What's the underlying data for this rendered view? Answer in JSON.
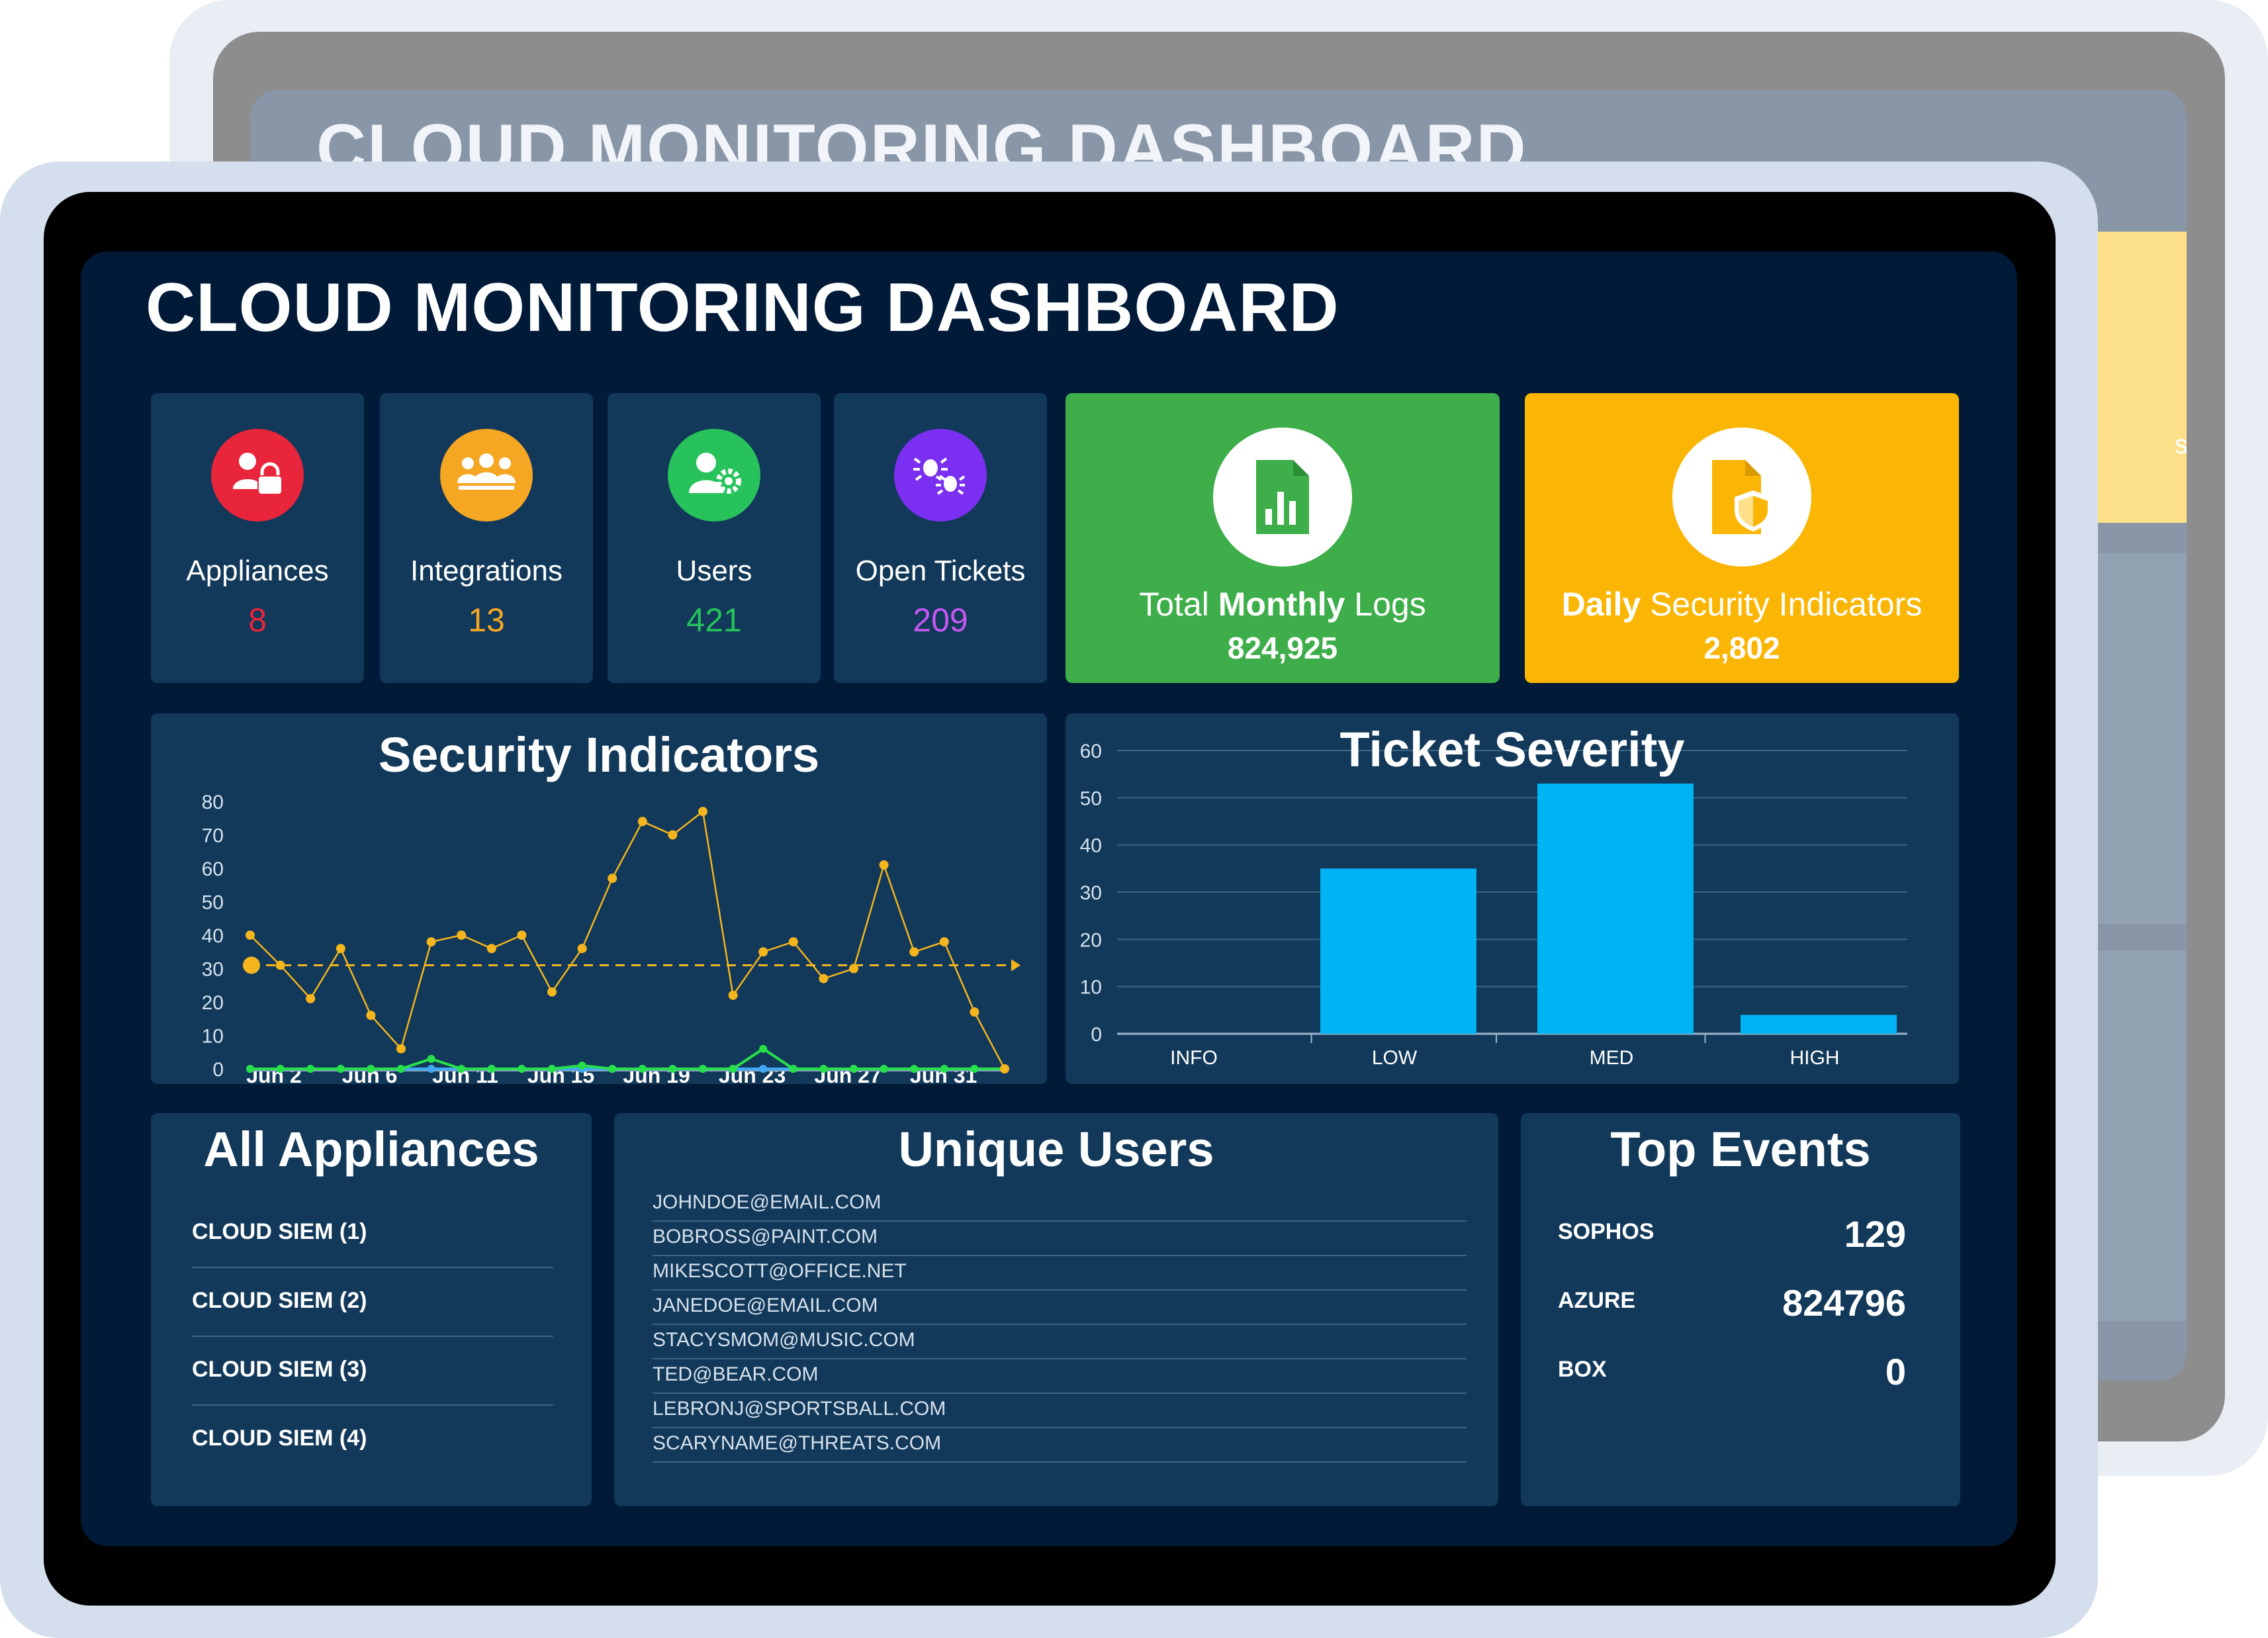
{
  "background_title": "CLOUD MONITORING DASHBOARD",
  "title": "CLOUD MONITORING DASHBOARD",
  "stats": [
    {
      "label": "Appliances",
      "value": "8",
      "color": "#e8253a",
      "icon": "appliance-lock-icon"
    },
    {
      "label": "Integrations",
      "value": "13",
      "color": "#f5a623",
      "icon": "team-icon"
    },
    {
      "label": "Users",
      "value": "421",
      "color": "#27c25c",
      "icon": "user-gear-icon"
    },
    {
      "label": "Open Tickets",
      "value": "209",
      "color": "#b64cf0",
      "icon": "bug-icon"
    }
  ],
  "monthly_logs": {
    "label_pre": "Total ",
    "label_bold": "Monthly",
    "label_post": " Logs",
    "value": "824,925",
    "color": "#3dae4a",
    "icon": "document-chart-icon"
  },
  "daily_indicators": {
    "label_bold": "Daily",
    "label_post": " Security Indicators",
    "value": "2,802",
    "color": "#fbb504",
    "icon": "document-shield-icon"
  },
  "security_chart": {
    "title": "Security Indicators",
    "yticks": [
      "0",
      "10",
      "20",
      "30",
      "40",
      "50",
      "60",
      "70",
      "80"
    ],
    "xticks": [
      "Jun 2",
      "Jun 6",
      "Jun 11",
      "Jun 15",
      "Jun 19",
      "Jun 23",
      "Jun 27",
      "Jun 31"
    ]
  },
  "severity_chart": {
    "title": "Ticket Severity",
    "yticks": [
      "0",
      "10",
      "20",
      "30",
      "40",
      "50",
      "60"
    ]
  },
  "chart_data": [
    {
      "type": "line",
      "title": "Security Indicators",
      "ylim": [
        0,
        80
      ],
      "x_tick_labels": [
        "Jun 2",
        "Jun 6",
        "Jun 11",
        "Jun 15",
        "Jun 19",
        "Jun 23",
        "Jun 27",
        "Jun 31"
      ],
      "x": [
        0,
        1,
        2,
        3,
        4,
        5,
        6,
        7,
        8,
        9,
        10,
        11,
        12,
        13,
        14,
        15,
        16,
        17,
        18,
        19,
        20,
        21,
        22,
        23,
        24,
        25,
        26,
        27,
        28,
        29,
        30,
        31,
        32
      ],
      "series": [
        {
          "color": "#f5b51c",
          "values": [
            40,
            31,
            21,
            36,
            16,
            6,
            38,
            40,
            36,
            40,
            23,
            36,
            57,
            74,
            70,
            77,
            22,
            35,
            38,
            27,
            30,
            61,
            35,
            38,
            17,
            0
          ]
        },
        {
          "color": "#27e04a",
          "values": [
            0,
            0,
            0,
            0,
            0,
            0,
            3,
            0,
            0,
            0,
            0,
            1,
            0,
            0,
            0,
            0,
            0,
            6,
            0,
            0,
            0,
            0,
            0,
            0,
            0,
            0
          ]
        },
        {
          "color": "#3fa9f5",
          "values": [
            0,
            0,
            0,
            0,
            0,
            0,
            0,
            0,
            0,
            0,
            0,
            0,
            0,
            0,
            0,
            0,
            0,
            0,
            0,
            0,
            0,
            0,
            0,
            0,
            0,
            0
          ]
        }
      ],
      "average": 31,
      "grid": false
    },
    {
      "type": "bar",
      "title": "Ticket Severity",
      "categories": [
        "INFO",
        "LOW",
        "MED",
        "HIGH"
      ],
      "values": [
        0,
        35,
        53,
        4
      ],
      "ylim": [
        0,
        60
      ],
      "grid": true,
      "color": "#00b3f5"
    }
  ],
  "appliances": {
    "title": "All Appliances",
    "items": [
      "CLOUD SIEM (1)",
      "CLOUD SIEM (2)",
      "CLOUD SIEM (3)",
      "CLOUD SIEM (4)"
    ]
  },
  "unique_users": {
    "title": "Unique Users",
    "items": [
      "JOHNDOE@EMAIL.COM",
      "BOBROSS@PAINT.COM",
      "MIKESCOTT@OFFICE.NET",
      "JANEDOE@EMAIL.COM",
      "STACYSMOM@MUSIC.COM",
      "TED@BEAR.COM",
      "LEBRONJ@SPORTSBALL.COM",
      "SCARYNAME@THREATS.COM"
    ]
  },
  "top_events": {
    "title": "Top Events",
    "items": [
      {
        "name": "SOPHOS",
        "value": "129"
      },
      {
        "name": "AZURE",
        "value": "824796"
      },
      {
        "name": "BOX",
        "value": "0"
      }
    ]
  }
}
